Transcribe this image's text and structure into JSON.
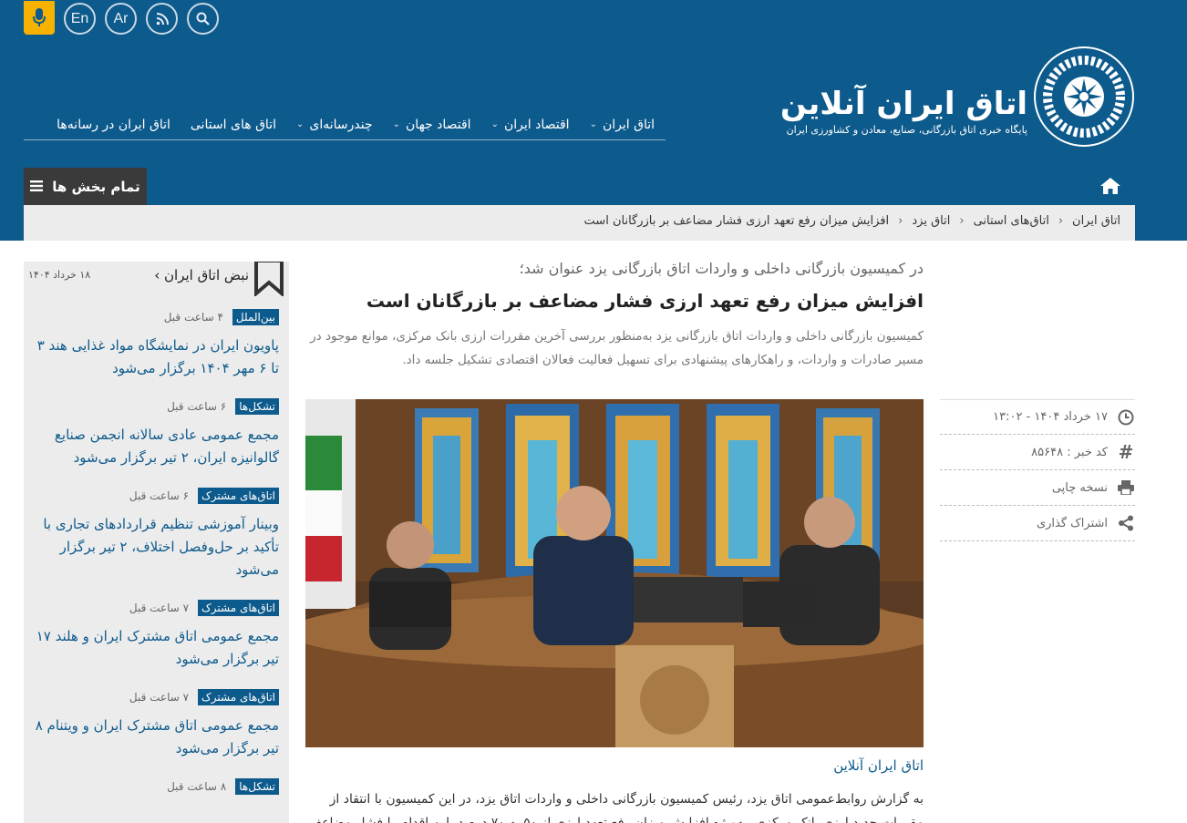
{
  "header": {
    "lang_en": "En",
    "lang_ar": "Ar",
    "logo_title": "اتاق ایران آنلاین",
    "logo_subtitle": "پایگاه خبری اتاق بازرگانی، صنایع، معادن و کشاورزی ایران",
    "colors": {
      "primary": "#0d5a8c",
      "accent": "#f7b100",
      "dark": "#3a3a3a"
    }
  },
  "nav": {
    "items": [
      {
        "label": "اتاق ایران",
        "dropdown": true
      },
      {
        "label": "اقتصاد ایران",
        "dropdown": true
      },
      {
        "label": "اقتصاد جهان",
        "dropdown": true
      },
      {
        "label": "چندرسانه‌ای",
        "dropdown": true
      },
      {
        "label": "اتاق های استانی",
        "dropdown": false
      },
      {
        "label": "اتاق ایران در رسانه‌ها",
        "dropdown": false
      }
    ],
    "all_sections": "تمام بخش ها"
  },
  "breadcrumb": [
    "اتاق ایران",
    "اتاق‌های استانی",
    "اتاق یزد",
    "افزایش میزان رفع تعهد ارزی فشار مضاعف بر بازرگانان است"
  ],
  "article": {
    "lead": "در کمیسیون بازرگانی داخلی و واردات اتاق بازرگانی یزد عنوان شد؛",
    "title": "افزایش میزان رفع تعهد ارزی فشار مضاعف بر بازرگانان است",
    "summary": "کمیسیون بازرگانی داخلی و واردات اتاق بازرگانی یزد به‌منظور بررسی آخرین مقررات ارزی بانک مرکزی، موانع موجود در مسیر صادرات و واردات، و راهکارهای پیشنهادی برای تسهیل فعالیت فعالان اقتصادی تشکیل جلسه داد.",
    "source": "اتاق ایران آنلاین",
    "body": "به گزارش روابط‌عمومی اتاق یزد، رئیس کمیسیون بازرگانی داخلی و واردات اتاق یزد، در این کمیسیون با انتقاد از مقررات جدید ارزی بانک مرکزی، به‌ویژه افزایش میزان رفع تعهد ارزی از ۵۰ به ۷۰ درصد، این اقدام را فشار مضاعف بر"
  },
  "meta": {
    "date": "۱۷ خرداد ۱۴۰۴ - ۱۳:۰۲",
    "code_label": "کد خبر : ۸۵۶۴۸",
    "print_label": "نسخه چاپی",
    "share_label": "اشتراک گذاری"
  },
  "sidebar": {
    "title": "نبض اتاق ایران",
    "date": "۱۸ خرداد ۱۴۰۴",
    "items": [
      {
        "tag": "بین‌الملل",
        "ago": "۴ ساعت قبل",
        "title": "پاویون ایران در نمایشگاه مواد غذایی هند ۳ تا ۶ مهر ۱۴۰۴ برگزار می‌شود"
      },
      {
        "tag": "تشکل‌ها",
        "ago": "۶ ساعت قبل",
        "title": "مجمع عمومی عادی سالانه انجمن صنایع گالوانیزه ایران، ۲ تیر برگزار می‌شود"
      },
      {
        "tag": "اتاق‌های مشترک",
        "ago": "۶ ساعت قبل",
        "title": "وبینار آموزشی تنظیم قراردادهای تجاری با تأکید بر حل‌وفصل اختلاف، ۲ تیر برگزار می‌شود"
      },
      {
        "tag": "اتاق‌های مشترک",
        "ago": "۷ ساعت قبل",
        "title": "مجمع عمومی اتاق مشترک ایران و هلند ۱۷ تیر برگزار می‌شود"
      },
      {
        "tag": "اتاق‌های مشترک",
        "ago": "۷ ساعت قبل",
        "title": "مجمع عمومی اتاق مشترک ایران و ویتنام ۸ تیر برگزار می‌شود"
      },
      {
        "tag": "تشکل‌ها",
        "ago": "۸ ساعت قبل",
        "title": ""
      }
    ]
  }
}
